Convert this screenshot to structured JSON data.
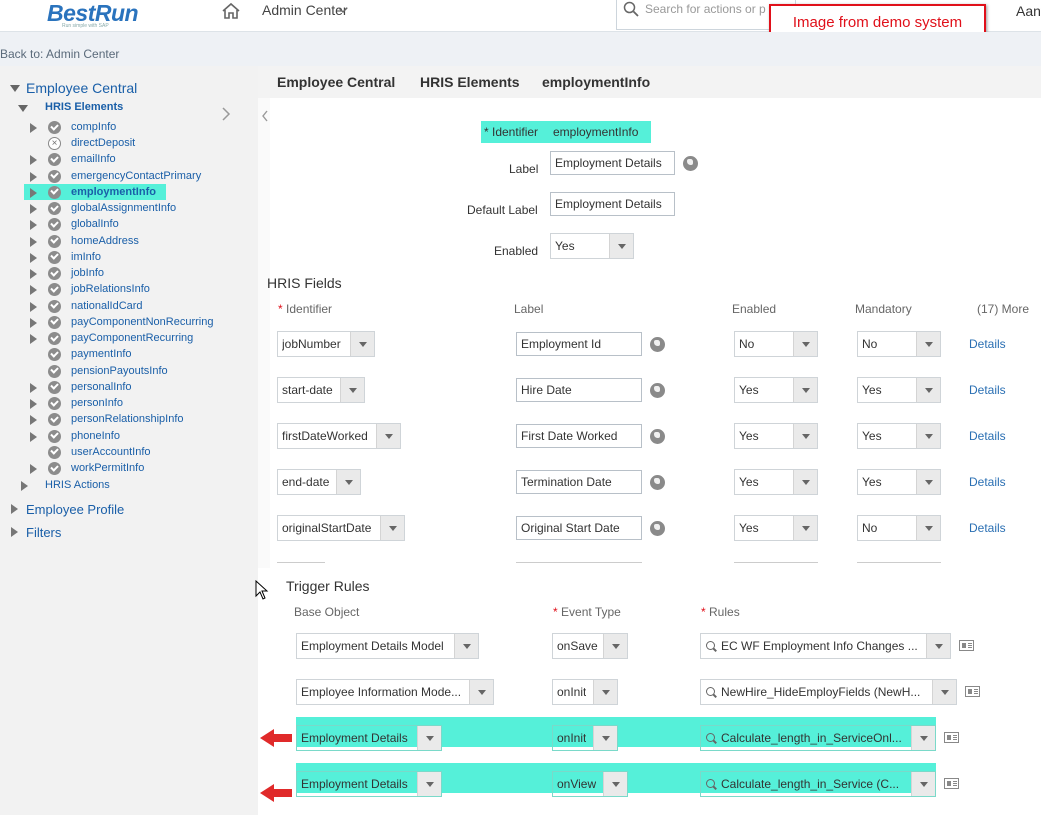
{
  "header": {
    "logo": "BestRun",
    "logo_tagline": "Run simple with SAP",
    "nav_title": "Admin Center",
    "search_placeholder": "Search for actions or p",
    "demo_badge": "Image from demo system",
    "user_name": "Aanya S",
    "back_link": "Back to: Admin Center"
  },
  "sidebar": {
    "root": "Employee Central",
    "group": "HRIS Elements",
    "items": [
      "compInfo",
      "directDeposit",
      "emailInfo",
      "emergencyContactPrimary",
      "employmentInfo",
      "globalAssignmentInfo",
      "globalInfo",
      "homeAddress",
      "imInfo",
      "jobInfo",
      "jobRelationsInfo",
      "nationalIdCard",
      "payComponentNonRecurring",
      "payComponentRecurring",
      "paymentInfo",
      "pensionPayoutsInfo",
      "personalInfo",
      "personInfo",
      "personRelationshipInfo",
      "phoneInfo",
      "userAccountInfo",
      "workPermitInfo"
    ],
    "hris_actions": "HRIS Actions",
    "employee_profile": "Employee Profile",
    "filters": "Filters"
  },
  "breadcrumb": [
    "Employee Central",
    "HRIS Elements",
    "employmentInfo"
  ],
  "element": {
    "identifier_label": "* Identifier",
    "identifier_value": "employmentInfo",
    "label_label": "Label",
    "label_value": "Employment Details",
    "default_label_label": "Default Label",
    "default_label_value": "Employment Details",
    "enabled_label": "Enabled",
    "enabled_value": "Yes"
  },
  "hris_fields": {
    "title": "HRIS Fields",
    "columns": {
      "identifier": "Identifier",
      "label": "Label",
      "enabled": "Enabled",
      "mandatory": "Mandatory",
      "more": "(17) More"
    },
    "details_label": "Details",
    "rows": [
      {
        "identifier": "jobNumber",
        "label": "Employment Id",
        "enabled": "No",
        "mandatory": "No"
      },
      {
        "identifier": "start-date",
        "label": "Hire Date",
        "enabled": "Yes",
        "mandatory": "Yes"
      },
      {
        "identifier": "firstDateWorked",
        "label": "First Date Worked",
        "enabled": "Yes",
        "mandatory": "Yes"
      },
      {
        "identifier": "end-date",
        "label": "Termination Date",
        "enabled": "Yes",
        "mandatory": "Yes"
      },
      {
        "identifier": "originalStartDate",
        "label": "Original Start Date",
        "enabled": "Yes",
        "mandatory": "No"
      }
    ]
  },
  "trigger_rules": {
    "title": "Trigger Rules",
    "columns": {
      "base_object": "Base Object",
      "event_type": "Event Type",
      "rules": "Rules"
    },
    "rows": [
      {
        "base_object": "Employment Details Model",
        "event": "onSave",
        "rule": "EC WF Employment Info Changes ..."
      },
      {
        "base_object": "Employee Information Mode...",
        "event": "onInit",
        "rule": "NewHire_HideEmployFields (NewH..."
      },
      {
        "base_object": "Employment Details",
        "event": "onInit",
        "rule": "Calculate_length_in_ServiceOnl..."
      },
      {
        "base_object": "Employment Details",
        "event": "onView",
        "rule": "Calculate_length_in_Service (C..."
      }
    ]
  },
  "colors": {
    "highlight": "#55f0d9",
    "annotation_red": "#e0101a",
    "link_blue": "#2a6fb3"
  }
}
